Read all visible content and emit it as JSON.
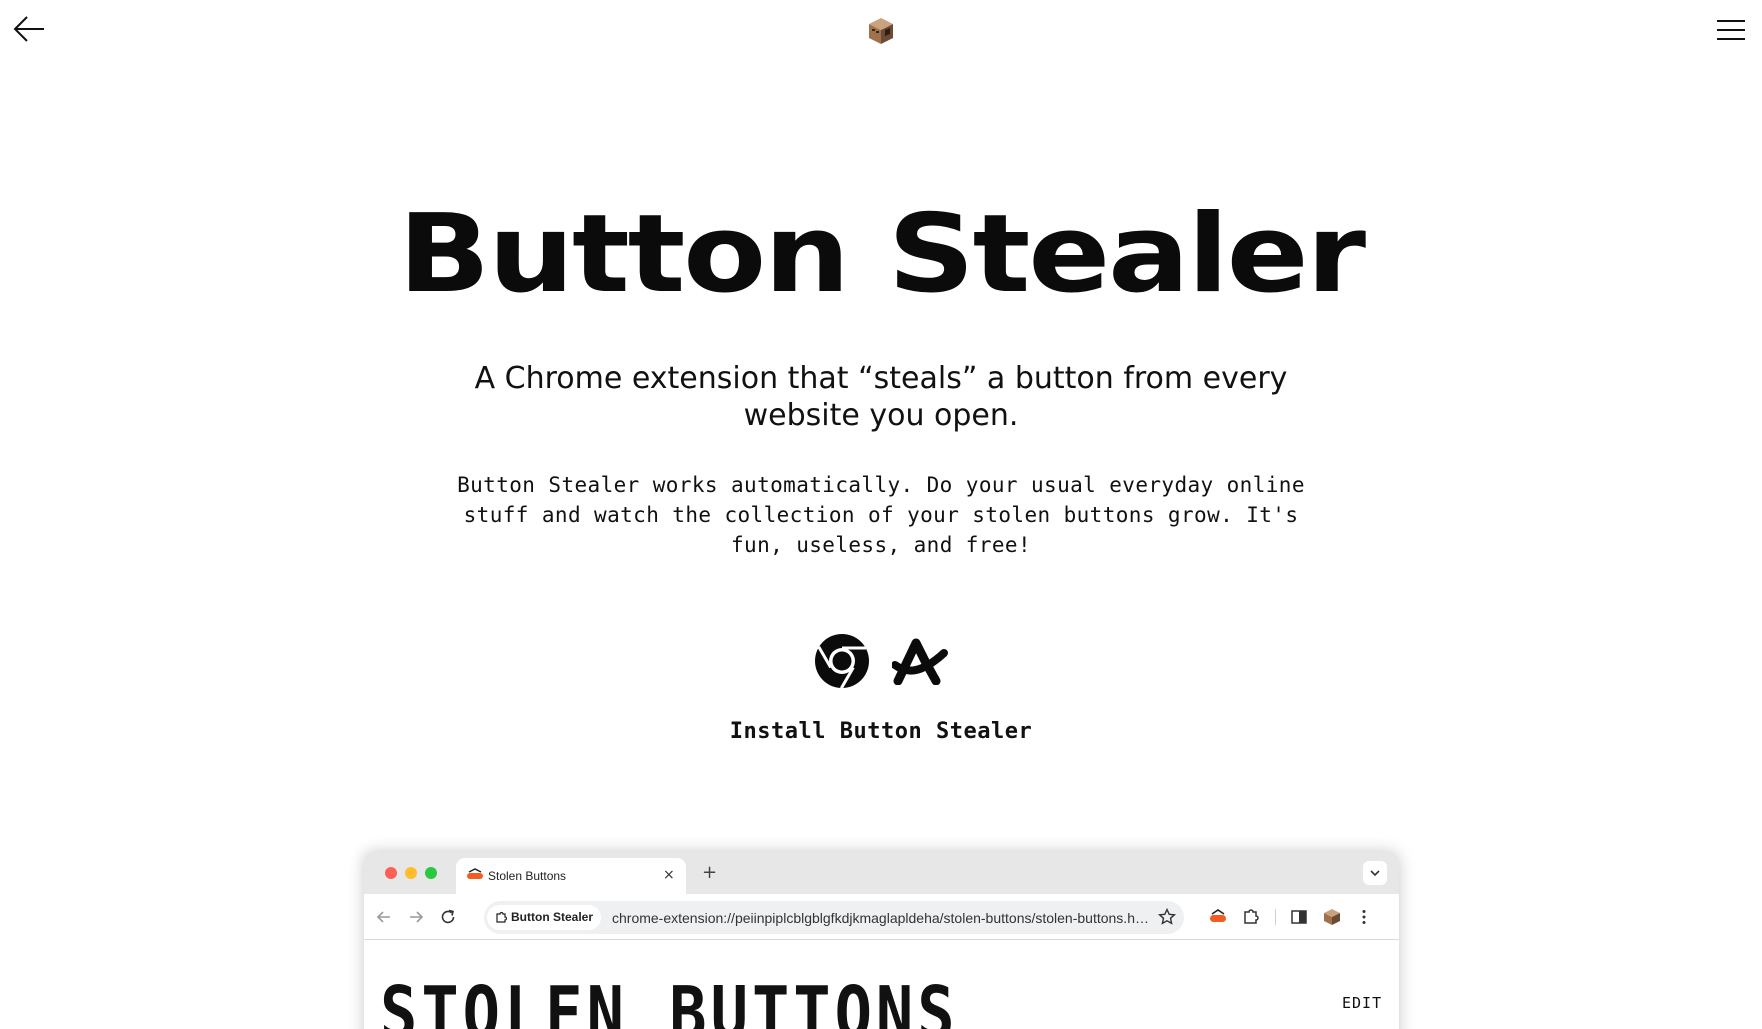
{
  "header": {
    "back_icon": "arrow-left-icon",
    "logo_icon": "cube-face-logo",
    "menu_icon": "hamburger-menu-icon"
  },
  "hero": {
    "title": "Button Stealer",
    "subtitle": "A Chrome extension that “steals” a button from every website you open.",
    "description": "Button Stealer works automatically. Do your usual everyday online stuff and watch the collection of your stolen buttons grow. It's fun, useless, and free!"
  },
  "install": {
    "icons": [
      "chrome-icon",
      "arc-browser-icon"
    ],
    "label": "Install Button Stealer"
  },
  "browser_preview": {
    "tab_title": "Stolen Buttons",
    "tab_close": "×",
    "new_tab": "+",
    "site_chip": "Button Stealer",
    "url": "chrome-extension://peiinpiplcblgblgfkdjkmaglapldeha/stolen-buttons/stolen-buttons.html",
    "page_heading": "STOLEN BUTTONS",
    "edit_label": "EDIT"
  },
  "colors": {
    "traffic_red": "#fe5f57",
    "traffic_yellow": "#febc2e",
    "traffic_green": "#28c840",
    "tabstrip_bg": "#e7e7e7",
    "omnibox_bg": "#eef0f2",
    "text": "#111111"
  }
}
